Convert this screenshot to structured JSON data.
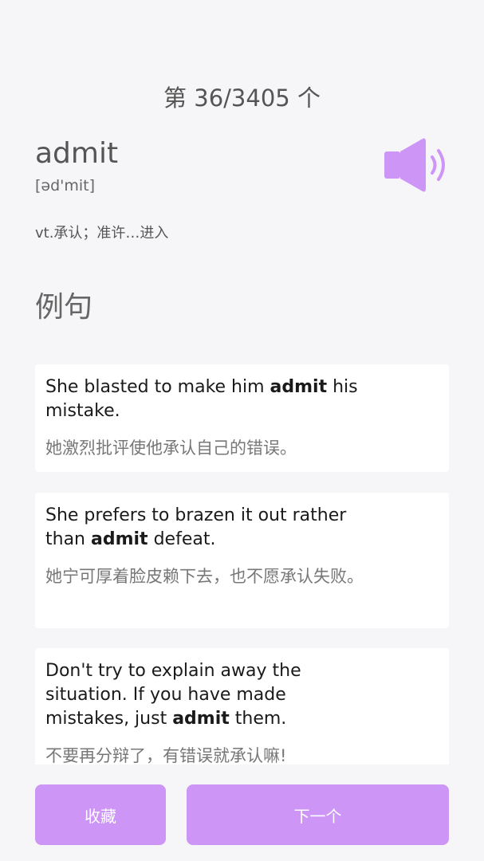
{
  "header": {
    "progress": "第 36/3405 个"
  },
  "word": {
    "text": "admit",
    "phonetic": "[əd'mit]",
    "definition": "vt.承认；准许…进入",
    "speaker_icon": "speaker-icon",
    "accent_color": "#cc95f6"
  },
  "examples": {
    "title": "例句",
    "items": [
      {
        "before": "She blasted to make him ",
        "highlight": "admit",
        "after": " his mistake.",
        "translation": "她激烈批评使他承认自己的错误。"
      },
      {
        "before": "She prefers to brazen it out rather than ",
        "highlight": "admit",
        "after": " defeat.",
        "translation": "她宁可厚着脸皮赖下去，也不愿承认失败。"
      },
      {
        "before": "Don't try to explain away the situation. If you have made mistakes, just ",
        "highlight": "admit",
        "after": " them.",
        "translation": "不要再分辩了，有错误就承认嘛!"
      }
    ]
  },
  "buttons": {
    "favorite": "收藏",
    "next": "下一个"
  }
}
